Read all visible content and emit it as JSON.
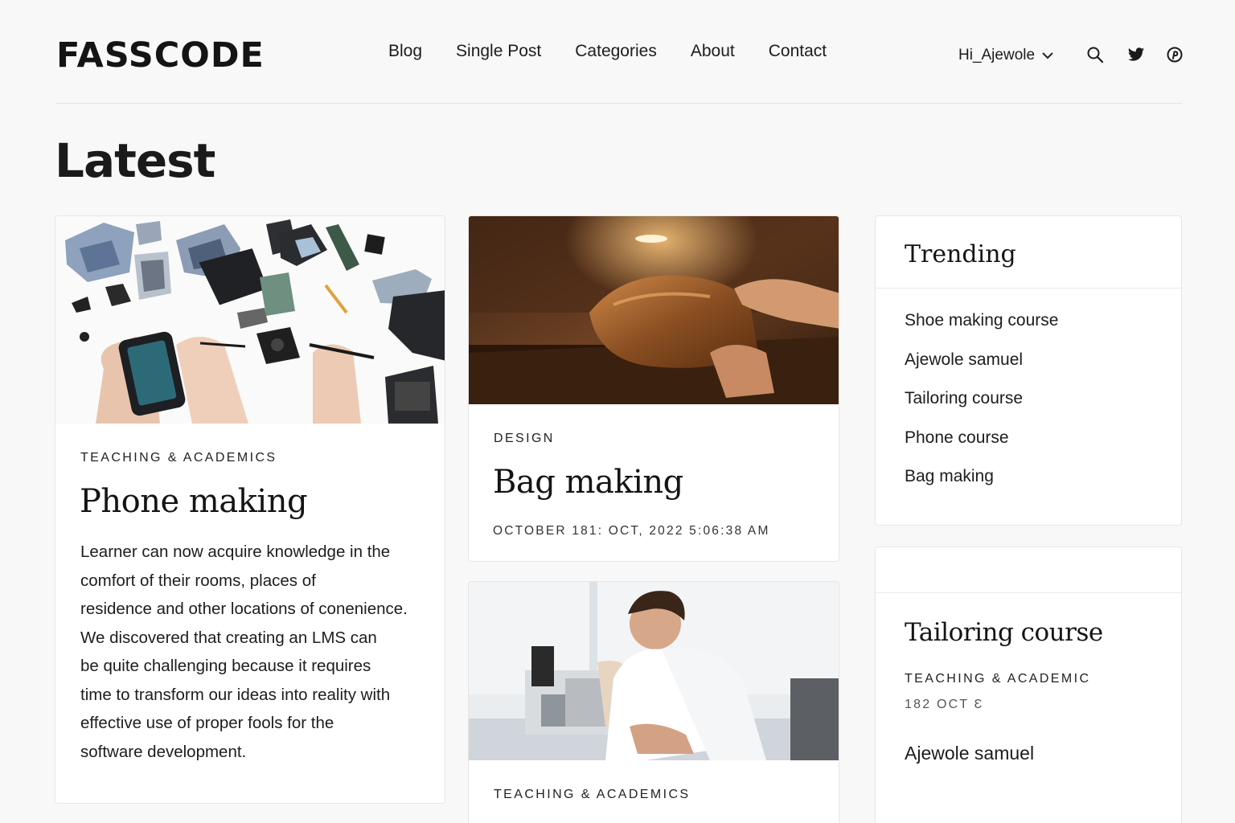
{
  "header": {
    "logo": "FASSCODE",
    "nav": [
      "Blog",
      "Single Post",
      "Categories",
      "About",
      "Contact"
    ],
    "user_label": "Hi_Ajewole",
    "icons": [
      "search-icon",
      "twitter-icon",
      "pinterest-icon"
    ]
  },
  "page": {
    "title": "Latest"
  },
  "cards": [
    {
      "category": "TEACHING & ACADEMICS",
      "title": "Phone making",
      "body_lines": [
        "Learner can now acquire knowledge in the",
        "comfort of their rooms, places of",
        "residence and other locations of conenience.",
        "We discovered that creating an LMS can",
        "be quite challenging because it requires",
        "time to transform our ideas into reality with",
        "effective use of proper fools for the",
        "software development."
      ]
    },
    {
      "category": "DESIGN",
      "title": "Bag making",
      "date": "OCTOBER 181: OCT, 2022 5:06:38 AM"
    },
    {
      "category": "TEACHING & ACADEMICS"
    }
  ],
  "sidebar": {
    "trending": {
      "title": "Trending",
      "items": [
        "Shoe making course",
        "Ajewole samuel",
        "Tailoring course",
        "Phone course",
        "Bag making"
      ]
    },
    "feature": {
      "title": "Tailoring course",
      "category": "TEACHING & ACADEMIC",
      "date": "182 OCT Ɛ",
      "author": "Ajewole samuel"
    }
  },
  "colors": {
    "text": "#1a1a1a",
    "background": "#f8f8f8",
    "card": "#ffffff",
    "border": "#e6e6e6"
  }
}
